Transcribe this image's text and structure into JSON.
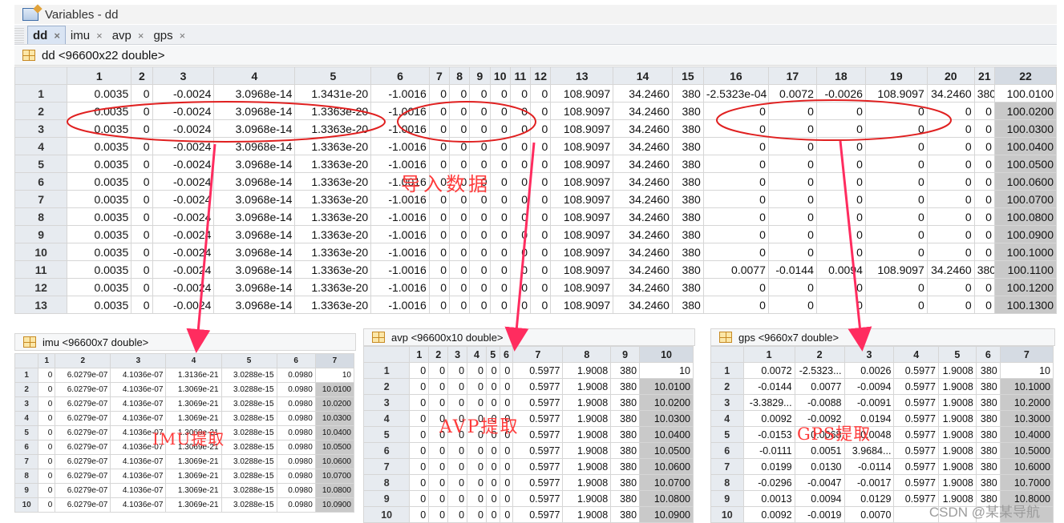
{
  "window": {
    "title": "Variables - dd"
  },
  "tabs": [
    {
      "label": "dd",
      "close": "×",
      "active": true
    },
    {
      "label": "imu",
      "close": "×",
      "active": false
    },
    {
      "label": "avp",
      "close": "×",
      "active": false
    },
    {
      "label": "gps",
      "close": "×",
      "active": false
    }
  ],
  "main": {
    "header": "dd <96600x22 double>",
    "columns": [
      "1",
      "2",
      "3",
      "4",
      "5",
      "6",
      "7",
      "8",
      "9",
      "10",
      "11",
      "12",
      "13",
      "14",
      "15",
      "16",
      "17",
      "18",
      "19",
      "20",
      "21",
      "22"
    ],
    "rows": [
      {
        "label": "1",
        "cells": [
          "0.0035",
          "0",
          "-0.0024",
          "3.0968e-14",
          "1.3431e-20",
          "-1.0016",
          "0",
          "0",
          "0",
          "0",
          "0",
          "0",
          "108.9097",
          "34.2460",
          "380",
          "-2.5323e-04",
          "0.0072",
          "-0.0026",
          "108.9097",
          "34.2460",
          "380",
          "100.0100"
        ]
      },
      {
        "label": "2",
        "cells": [
          "0.0035",
          "0",
          "-0.0024",
          "3.0968e-14",
          "1.3363e-20",
          "-1.0016",
          "0",
          "0",
          "0",
          "0",
          "0",
          "0",
          "108.9097",
          "34.2460",
          "380",
          "0",
          "0",
          "0",
          "0",
          "0",
          "0",
          "100.0200"
        ]
      },
      {
        "label": "3",
        "cells": [
          "0.0035",
          "0",
          "-0.0024",
          "3.0968e-14",
          "1.3363e-20",
          "-1.0016",
          "0",
          "0",
          "0",
          "0",
          "0",
          "0",
          "108.9097",
          "34.2460",
          "380",
          "0",
          "0",
          "0",
          "0",
          "0",
          "0",
          "100.0300"
        ]
      },
      {
        "label": "4",
        "cells": [
          "0.0035",
          "0",
          "-0.0024",
          "3.0968e-14",
          "1.3363e-20",
          "-1.0016",
          "0",
          "0",
          "0",
          "0",
          "0",
          "0",
          "108.9097",
          "34.2460",
          "380",
          "0",
          "0",
          "0",
          "0",
          "0",
          "0",
          "100.0400"
        ]
      },
      {
        "label": "5",
        "cells": [
          "0.0035",
          "0",
          "-0.0024",
          "3.0968e-14",
          "1.3363e-20",
          "-1.0016",
          "0",
          "0",
          "0",
          "0",
          "0",
          "0",
          "108.9097",
          "34.2460",
          "380",
          "0",
          "0",
          "0",
          "0",
          "0",
          "0",
          "100.0500"
        ]
      },
      {
        "label": "6",
        "cells": [
          "0.0035",
          "0",
          "-0.0024",
          "3.0968e-14",
          "1.3363e-20",
          "-1.0016",
          "0",
          "0",
          "0",
          "0",
          "0",
          "0",
          "108.9097",
          "34.2460",
          "380",
          "0",
          "0",
          "0",
          "0",
          "0",
          "0",
          "100.0600"
        ]
      },
      {
        "label": "7",
        "cells": [
          "0.0035",
          "0",
          "-0.0024",
          "3.0968e-14",
          "1.3363e-20",
          "-1.0016",
          "0",
          "0",
          "0",
          "0",
          "0",
          "0",
          "108.9097",
          "34.2460",
          "380",
          "0",
          "0",
          "0",
          "0",
          "0",
          "0",
          "100.0700"
        ]
      },
      {
        "label": "8",
        "cells": [
          "0.0035",
          "0",
          "-0.0024",
          "3.0968e-14",
          "1.3363e-20",
          "-1.0016",
          "0",
          "0",
          "0",
          "0",
          "0",
          "0",
          "108.9097",
          "34.2460",
          "380",
          "0",
          "0",
          "0",
          "0",
          "0",
          "0",
          "100.0800"
        ]
      },
      {
        "label": "9",
        "cells": [
          "0.0035",
          "0",
          "-0.0024",
          "3.0968e-14",
          "1.3363e-20",
          "-1.0016",
          "0",
          "0",
          "0",
          "0",
          "0",
          "0",
          "108.9097",
          "34.2460",
          "380",
          "0",
          "0",
          "0",
          "0",
          "0",
          "0",
          "100.0900"
        ]
      },
      {
        "label": "10",
        "cells": [
          "0.0035",
          "0",
          "-0.0024",
          "3.0968e-14",
          "1.3363e-20",
          "-1.0016",
          "0",
          "0",
          "0",
          "0",
          "0",
          "0",
          "108.9097",
          "34.2460",
          "380",
          "0",
          "0",
          "0",
          "0",
          "0",
          "0",
          "100.1000"
        ]
      },
      {
        "label": "11",
        "cells": [
          "0.0035",
          "0",
          "-0.0024",
          "3.0968e-14",
          "1.3363e-20",
          "-1.0016",
          "0",
          "0",
          "0",
          "0",
          "0",
          "0",
          "108.9097",
          "34.2460",
          "380",
          "0.0077",
          "-0.0144",
          "0.0094",
          "108.9097",
          "34.2460",
          "380",
          "100.1100"
        ]
      },
      {
        "label": "12",
        "cells": [
          "0.0035",
          "0",
          "-0.0024",
          "3.0968e-14",
          "1.3363e-20",
          "-1.0016",
          "0",
          "0",
          "0",
          "0",
          "0",
          "0",
          "108.9097",
          "34.2460",
          "380",
          "0",
          "0",
          "0",
          "0",
          "0",
          "0",
          "100.1200"
        ]
      },
      {
        "label": "13",
        "cells": [
          "0.0035",
          "0",
          "-0.0024",
          "3.0968e-14",
          "1.3363e-20",
          "-1.0016",
          "0",
          "0",
          "0",
          "0",
          "0",
          "0",
          "108.9097",
          "34.2460",
          "380",
          "0",
          "0",
          "0",
          "0",
          "0",
          "0",
          "100.1300"
        ]
      }
    ]
  },
  "imu": {
    "header": "imu <96600x7 double>",
    "columns": [
      "1",
      "2",
      "3",
      "4",
      "5",
      "6",
      "7"
    ],
    "rows": [
      {
        "label": "1",
        "cells": [
          "0",
          "6.0279e-07",
          "4.1036e-07",
          "1.3136e-21",
          "3.0288e-15",
          "0.0980",
          "10"
        ]
      },
      {
        "label": "2",
        "cells": [
          "0",
          "6.0279e-07",
          "4.1036e-07",
          "1.3069e-21",
          "3.0288e-15",
          "0.0980",
          "10.0100"
        ]
      },
      {
        "label": "3",
        "cells": [
          "0",
          "6.0279e-07",
          "4.1036e-07",
          "1.3069e-21",
          "3.0288e-15",
          "0.0980",
          "10.0200"
        ]
      },
      {
        "label": "4",
        "cells": [
          "0",
          "6.0279e-07",
          "4.1036e-07",
          "1.3069e-21",
          "3.0288e-15",
          "0.0980",
          "10.0300"
        ]
      },
      {
        "label": "5",
        "cells": [
          "0",
          "6.0279e-07",
          "4.1036e-07",
          "1.3069e-21",
          "3.0288e-15",
          "0.0980",
          "10.0400"
        ]
      },
      {
        "label": "6",
        "cells": [
          "0",
          "6.0279e-07",
          "4.1036e-07",
          "1.3069e-21",
          "3.0288e-15",
          "0.0980",
          "10.0500"
        ]
      },
      {
        "label": "7",
        "cells": [
          "0",
          "6.0279e-07",
          "4.1036e-07",
          "1.3069e-21",
          "3.0288e-15",
          "0.0980",
          "10.0600"
        ]
      },
      {
        "label": "8",
        "cells": [
          "0",
          "6.0279e-07",
          "4.1036e-07",
          "1.3069e-21",
          "3.0288e-15",
          "0.0980",
          "10.0700"
        ]
      },
      {
        "label": "9",
        "cells": [
          "0",
          "6.0279e-07",
          "4.1036e-07",
          "1.3069e-21",
          "3.0288e-15",
          "0.0980",
          "10.0800"
        ]
      },
      {
        "label": "10",
        "cells": [
          "0",
          "6.0279e-07",
          "4.1036e-07",
          "1.3069e-21",
          "3.0288e-15",
          "0.0980",
          "10.0900"
        ]
      }
    ]
  },
  "avp": {
    "header": "avp <96600x10 double>",
    "columns": [
      "1",
      "2",
      "3",
      "4",
      "5",
      "6",
      "7",
      "8",
      "9",
      "10"
    ],
    "rows": [
      {
        "label": "1",
        "cells": [
          "0",
          "0",
          "0",
          "0",
          "0",
          "0",
          "0.5977",
          "1.9008",
          "380",
          "10"
        ]
      },
      {
        "label": "2",
        "cells": [
          "0",
          "0",
          "0",
          "0",
          "0",
          "0",
          "0.5977",
          "1.9008",
          "380",
          "10.0100"
        ]
      },
      {
        "label": "3",
        "cells": [
          "0",
          "0",
          "0",
          "0",
          "0",
          "0",
          "0.5977",
          "1.9008",
          "380",
          "10.0200"
        ]
      },
      {
        "label": "4",
        "cells": [
          "0",
          "0",
          "0",
          "0",
          "0",
          "0",
          "0.5977",
          "1.9008",
          "380",
          "10.0300"
        ]
      },
      {
        "label": "5",
        "cells": [
          "0",
          "0",
          "0",
          "0",
          "0",
          "0",
          "0.5977",
          "1.9008",
          "380",
          "10.0400"
        ]
      },
      {
        "label": "6",
        "cells": [
          "0",
          "0",
          "0",
          "0",
          "0",
          "0",
          "0.5977",
          "1.9008",
          "380",
          "10.0500"
        ]
      },
      {
        "label": "7",
        "cells": [
          "0",
          "0",
          "0",
          "0",
          "0",
          "0",
          "0.5977",
          "1.9008",
          "380",
          "10.0600"
        ]
      },
      {
        "label": "8",
        "cells": [
          "0",
          "0",
          "0",
          "0",
          "0",
          "0",
          "0.5977",
          "1.9008",
          "380",
          "10.0700"
        ]
      },
      {
        "label": "9",
        "cells": [
          "0",
          "0",
          "0",
          "0",
          "0",
          "0",
          "0.5977",
          "1.9008",
          "380",
          "10.0800"
        ]
      },
      {
        "label": "10",
        "cells": [
          "0",
          "0",
          "0",
          "0",
          "0",
          "0",
          "0.5977",
          "1.9008",
          "380",
          "10.0900"
        ]
      }
    ]
  },
  "gps": {
    "header": "gps <9660x7 double>",
    "columns": [
      "1",
      "2",
      "3",
      "4",
      "5",
      "6",
      "7"
    ],
    "rows": [
      {
        "label": "1",
        "cells": [
          "0.0072",
          "-2.5323...",
          "0.0026",
          "0.5977",
          "1.9008",
          "380",
          "10"
        ]
      },
      {
        "label": "2",
        "cells": [
          "-0.0144",
          "0.0077",
          "-0.0094",
          "0.5977",
          "1.9008",
          "380",
          "10.1000"
        ]
      },
      {
        "label": "3",
        "cells": [
          "-3.3829...",
          "-0.0088",
          "-0.0091",
          "0.5977",
          "1.9008",
          "380",
          "10.2000"
        ]
      },
      {
        "label": "4",
        "cells": [
          "0.0092",
          "-0.0092",
          "0.0194",
          "0.5977",
          "1.9008",
          "380",
          "10.3000"
        ]
      },
      {
        "label": "5",
        "cells": [
          "-0.0153",
          "0.0068",
          "0.0048",
          "0.5977",
          "1.9008",
          "380",
          "10.4000"
        ]
      },
      {
        "label": "6",
        "cells": [
          "-0.0111",
          "0.0051",
          "3.9684...",
          "0.5977",
          "1.9008",
          "380",
          "10.5000"
        ]
      },
      {
        "label": "7",
        "cells": [
          "0.0199",
          "0.0130",
          "-0.0114",
          "0.5977",
          "1.9008",
          "380",
          "10.6000"
        ]
      },
      {
        "label": "8",
        "cells": [
          "-0.0296",
          "-0.0047",
          "-0.0017",
          "0.5977",
          "1.9008",
          "380",
          "10.7000"
        ]
      },
      {
        "label": "9",
        "cells": [
          "0.0013",
          "0.0094",
          "0.0129",
          "0.5977",
          "1.9008",
          "380",
          "10.8000"
        ]
      },
      {
        "label": "10",
        "cells": [
          "0.0092",
          "-0.0019",
          "0.0070",
          "",
          "",
          "",
          ""
        ]
      }
    ]
  },
  "annotations": {
    "import": "导入数据",
    "imu": "IMU提取",
    "avp": "AVP提取",
    "gps": "GPS提取",
    "color": "#ff3b3b"
  },
  "watermark": "CSDN @某某导航"
}
